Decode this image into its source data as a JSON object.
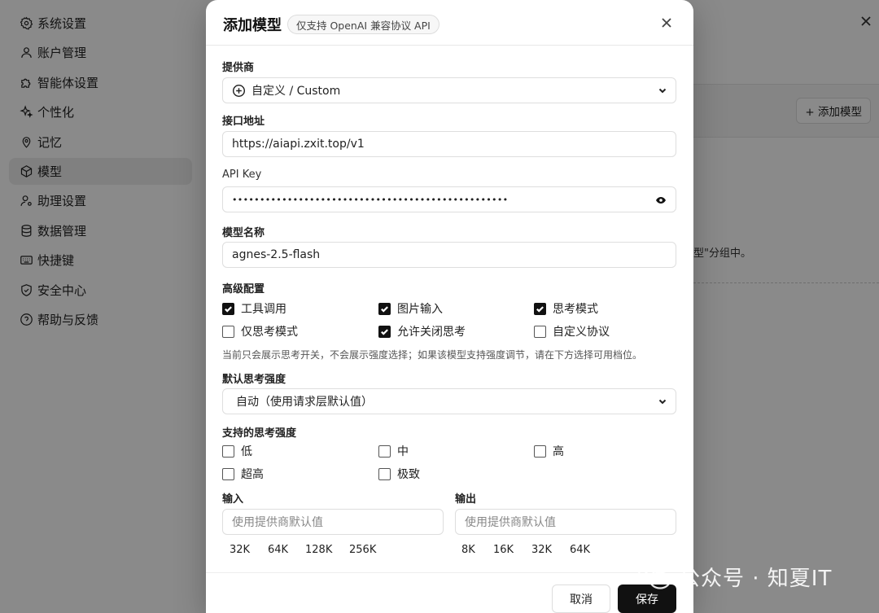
{
  "sidebar": {
    "items": [
      {
        "label": "系统设置",
        "icon": "gear-icon"
      },
      {
        "label": "账户管理",
        "icon": "user-icon"
      },
      {
        "label": "智能体设置",
        "icon": "puzzle-icon"
      },
      {
        "label": "个性化",
        "icon": "sparkle-icon"
      },
      {
        "label": "记忆",
        "icon": "pin-icon"
      },
      {
        "label": "模型",
        "icon": "cube-icon",
        "active": true
      },
      {
        "label": "助理设置",
        "icon": "user-gear-icon"
      },
      {
        "label": "数据管理",
        "icon": "database-icon"
      },
      {
        "label": "快捷键",
        "icon": "keyboard-icon"
      },
      {
        "label": "安全中心",
        "icon": "shield-icon"
      },
      {
        "label": "帮助与反馈",
        "icon": "help-icon"
      }
    ]
  },
  "main": {
    "add_model_label": "+ 添加模型",
    "group_text": "型\"分组中。"
  },
  "dialog": {
    "title": "添加模型",
    "badge": "仅支持 OpenAI 兼容协议 API",
    "provider_label": "提供商",
    "provider_value": "自定义 / Custom",
    "endpoint_label": "接口地址",
    "endpoint_value": "https://aiapi.zxit.top/v1",
    "apikey_label": "API Key",
    "apikey_masked": "••••••••••••••••••••••••••••••••••••••••••••••••••",
    "model_name_label": "模型名称",
    "model_name_value": "agnes-2.5-flash",
    "advanced_label": "高级配置",
    "advanced_options": [
      {
        "label": "工具调用",
        "checked": true
      },
      {
        "label": "图片输入",
        "checked": true
      },
      {
        "label": "思考模式",
        "checked": true
      },
      {
        "label": "仅思考模式",
        "checked": false
      },
      {
        "label": "允许关闭思考",
        "checked": true
      },
      {
        "label": "自定义协议",
        "checked": false
      }
    ],
    "hint": "当前只会展示思考开关，不会展示强度选择；如果该模型支持强度调节，请在下方选择可用档位。",
    "default_strength_label": "默认思考强度",
    "default_strength_value": "自动（使用请求层默认值）",
    "supported_strength_label": "支持的思考强度",
    "strength_options": [
      {
        "label": "低",
        "checked": false
      },
      {
        "label": "中",
        "checked": false
      },
      {
        "label": "高",
        "checked": false
      },
      {
        "label": "超高",
        "checked": false
      },
      {
        "label": "极致",
        "checked": false
      }
    ],
    "input_label": "输入",
    "input_placeholder": "使用提供商默认值",
    "input_chips": [
      "32K",
      "64K",
      "128K",
      "256K"
    ],
    "output_label": "输出",
    "output_placeholder": "使用提供商默认值",
    "output_chips": [
      "8K",
      "16K",
      "32K",
      "64K"
    ],
    "cancel_label": "取消",
    "save_label": "保存"
  },
  "watermark": "公众号 · 知夏IT"
}
